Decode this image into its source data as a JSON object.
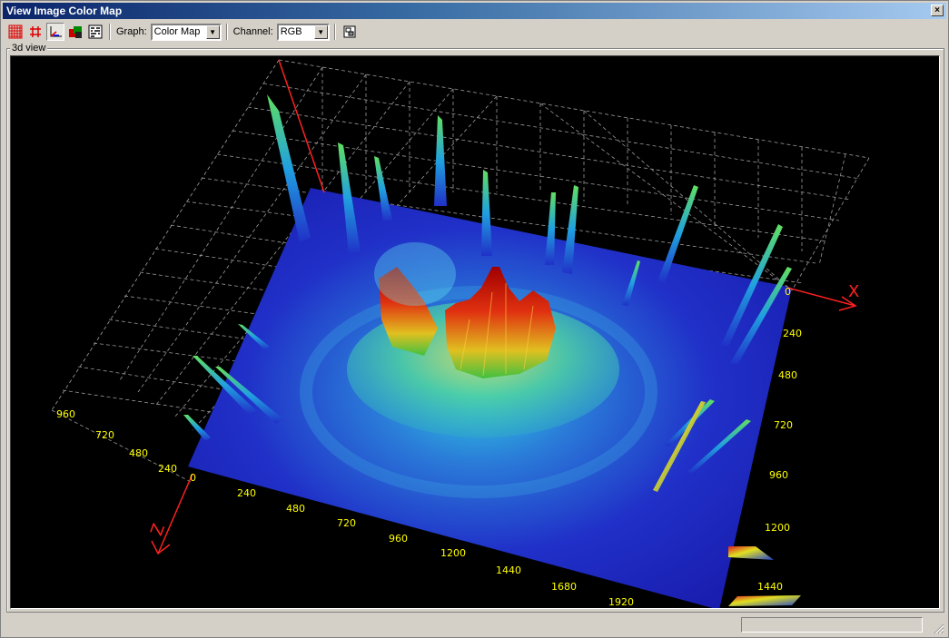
{
  "window": {
    "title": "View Image Color Map",
    "close_glyph": "×"
  },
  "toolbar": {
    "graph_label": "Graph:",
    "graph_value": "Color Map",
    "channel_label": "Channel:",
    "channel_value": "RGB",
    "buttons": [
      "grid-red-icon",
      "grid-lines-icon",
      "axes-icon",
      "color-palette-icon",
      "pattern-icon",
      "export-icon"
    ]
  },
  "view": {
    "group_title": "3d view",
    "x_axis_label": "X",
    "z_axis_label": "Z",
    "right_ticks": [
      "0",
      "240",
      "480",
      "720",
      "960",
      "1200",
      "1440"
    ],
    "bottom_ticks": [
      "0",
      "240",
      "480",
      "720",
      "960",
      "1200",
      "1440",
      "1680",
      "1920"
    ],
    "left_ticks": [
      "960",
      "720",
      "480",
      "240"
    ],
    "colors": {
      "axis": "#ff2020",
      "tick": "#ffff00",
      "surface_low": "#1a1acc",
      "surface_high": "#cc1010"
    }
  }
}
